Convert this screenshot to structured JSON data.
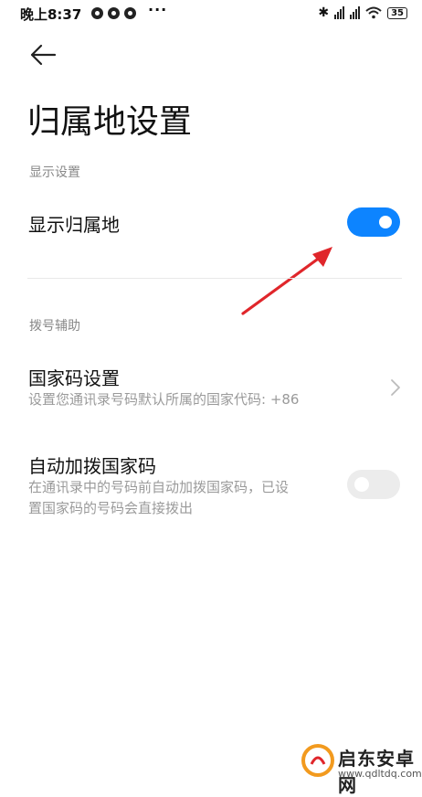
{
  "status_bar": {
    "time": "晚上8:37",
    "dots": "···",
    "battery": "35"
  },
  "header": {
    "title": "归属地设置"
  },
  "sections": {
    "display": {
      "header": "显示设置",
      "show_location": {
        "label": "显示归属地",
        "enabled": true
      }
    },
    "dial_assist": {
      "header": "拨号辅助",
      "country_code": {
        "title": "国家码设置",
        "subtitle": "设置您通讯录号码默认所属的国家代码: +86"
      },
      "auto_country_code": {
        "title": "自动加拨国家码",
        "subtitle_line1": "在通讯录中的号码前自动加拨国家码，已设",
        "subtitle_line2": "置国家码的号码会直接拨出",
        "enabled": false
      }
    }
  },
  "watermark": {
    "name": "启东安卓网",
    "url": "www.qdltdq.com"
  },
  "colors": {
    "accent": "#0d84ff",
    "annotation_arrow": "#e0262b",
    "section_text": "#888888"
  }
}
